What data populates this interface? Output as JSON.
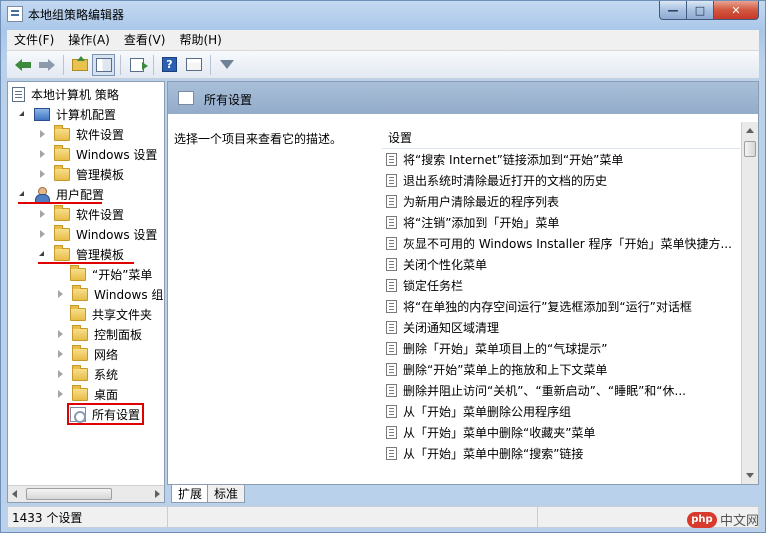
{
  "window": {
    "title": "本地组策略编辑器",
    "minimize_label": "—",
    "maximize_label": "□",
    "close_label": "✕"
  },
  "menu": [
    "文件(F)",
    "操作(A)",
    "查看(V)",
    "帮助(H)"
  ],
  "toolbar": {
    "help_label": "?"
  },
  "tree": {
    "root": "本地计算机 策略",
    "computer_config": "计算机配置",
    "computer_children": [
      "软件设置",
      "Windows 设置",
      "管理模板"
    ],
    "user_config": "用户配置",
    "user_children": [
      "软件设置",
      "Windows 设置"
    ],
    "admin_templates": "管理模板",
    "admin_children": [
      "“开始”菜单",
      "Windows 组件",
      "共享文件夹",
      "控制面板",
      "网络",
      "系统",
      "桌面"
    ],
    "all_settings": "所有设置"
  },
  "content": {
    "header_title": "所有设置",
    "description": "选择一个项目来查看它的描述。",
    "column_header": "设置",
    "items": [
      "将“搜索 Internet”链接添加到“开始”菜单",
      "退出系统时清除最近打开的文档的历史",
      "为新用户清除最近的程序列表",
      "将“注销”添加到「开始」菜单",
      "灰显不可用的 Windows Installer 程序「开始」菜单快捷方...",
      "关闭个性化菜单",
      "锁定任务栏",
      "将“在单独的内存空间运行”复选框添加到“运行”对话框",
      "关闭通知区域清理",
      "删除「开始」菜单项目上的“气球提示”",
      "删除“开始”菜单上的拖放和上下文菜单",
      "删除并阻止访问“关机”、“重新启动”、“睡眠”和“休...",
      "从「开始」菜单删除公用程序组",
      "从「开始」菜单中删除“收藏夹”菜单",
      "从「开始」菜单中删除“搜索”链接"
    ]
  },
  "tabs": [
    "扩展",
    "标准"
  ],
  "status": {
    "count_text": "1433 个设置"
  },
  "watermark": {
    "badge": "php",
    "text": "中文网"
  }
}
